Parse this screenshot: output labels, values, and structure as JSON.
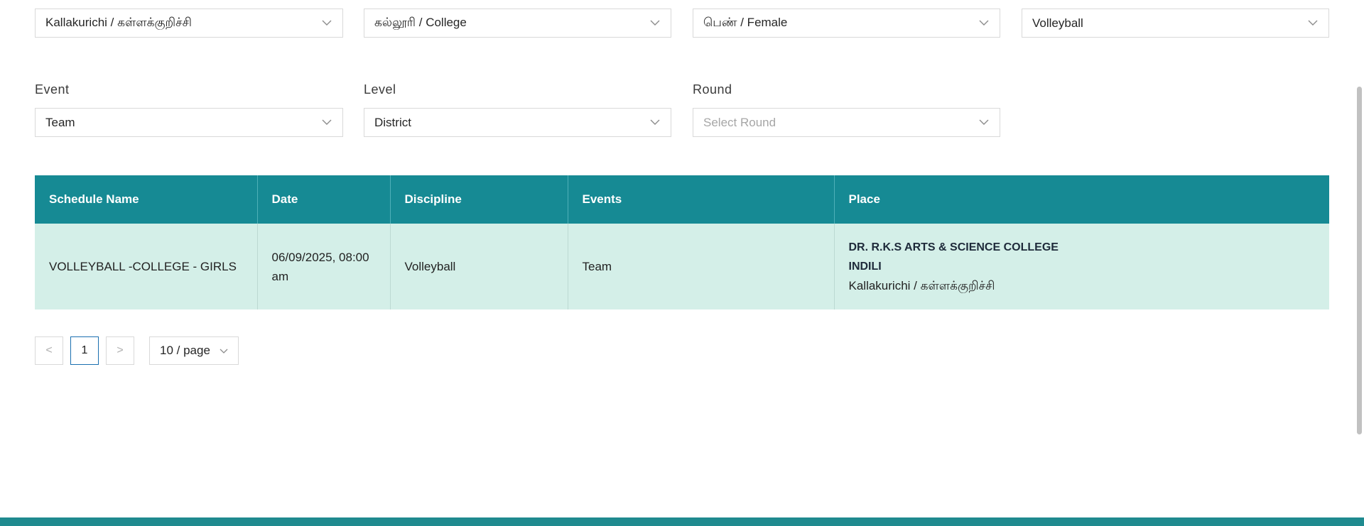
{
  "filters_row1": [
    {
      "value": "Kallakurichi / கள்ளக்குறிச்சி"
    },
    {
      "value": "கல்லூரி / College"
    },
    {
      "value": "பெண் / Female"
    },
    {
      "value": "Volleyball"
    }
  ],
  "filters_row2": [
    {
      "label": "Event",
      "value": "Team",
      "placeholder": false
    },
    {
      "label": "Level",
      "value": "District",
      "placeholder": false
    },
    {
      "label": "Round",
      "value": "Select Round",
      "placeholder": true
    }
  ],
  "table": {
    "headers": [
      "Schedule Name",
      "Date",
      "Discipline",
      "Events",
      "Place"
    ],
    "rows": [
      {
        "schedule_name": "VOLLEYBALL -COLLEGE - GIRLS",
        "date_line1": "06/09/2025, 08:00",
        "date_line2": "am",
        "discipline": "Volleyball",
        "events": "Team",
        "place_line1": "DR. R.K.S ARTS & SCIENCE COLLEGE",
        "place_line2": "INDILI",
        "place_line3": "Kallakurichi / கள்ளக்குறிச்சி"
      }
    ]
  },
  "pagination": {
    "prev": "<",
    "current": "1",
    "next": ">",
    "page_size": "10 / page"
  },
  "icons": {
    "chevron": "chevron-down-icon"
  },
  "colors": {
    "header_bg": "#168a94",
    "row_bg": "#d4efe8",
    "footer": "#1f8a8f"
  }
}
